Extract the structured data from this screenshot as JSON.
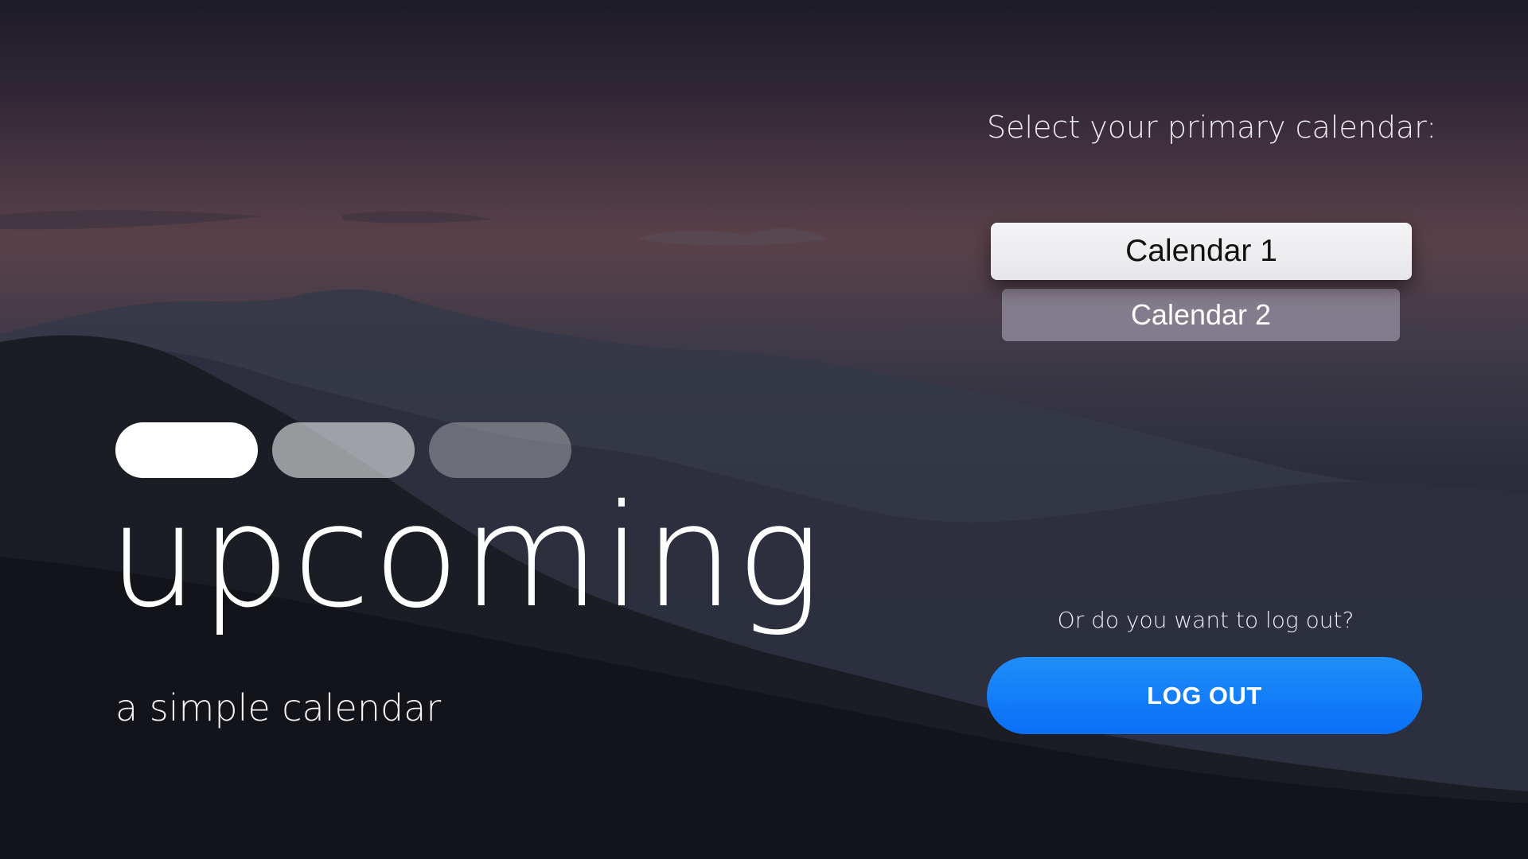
{
  "brand": {
    "title": "upcoming",
    "subtitle": "a simple calendar",
    "pills": [
      "pill-1",
      "pill-2",
      "pill-3"
    ]
  },
  "calendar_select": {
    "prompt": "Select your primary calendar:",
    "options": [
      {
        "label": "Calendar 1",
        "selected": true
      },
      {
        "label": "Calendar 2",
        "selected": false
      }
    ]
  },
  "logout": {
    "prompt": "Or do you want to log out?",
    "button_label": "LOG OUT"
  },
  "colors": {
    "accent_blue": "#0A6FF7",
    "selected_option_bg": "#F0EFF2",
    "unselected_option_bg": "#8F8A9B",
    "text_primary": "#FFFFFF"
  }
}
